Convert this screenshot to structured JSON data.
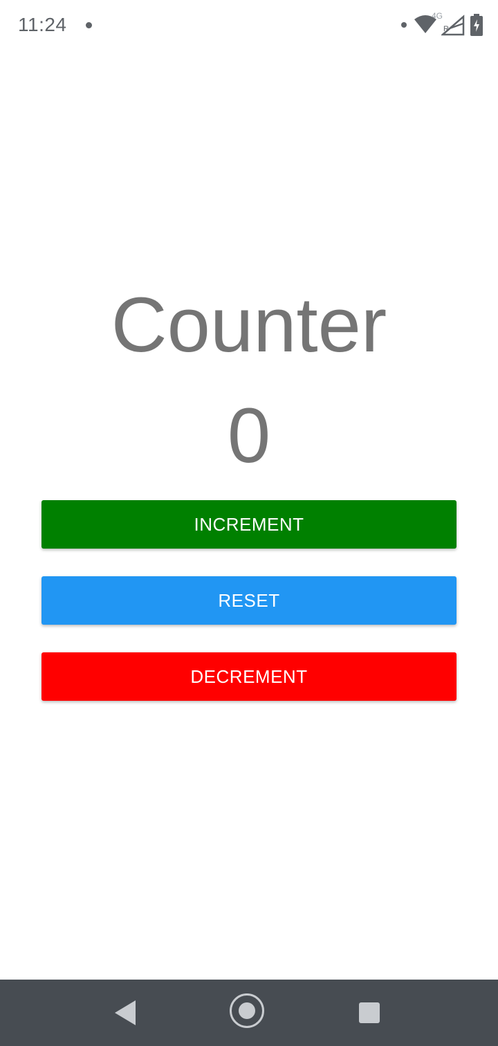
{
  "status_bar": {
    "time": "11:24",
    "network_label": "4G",
    "roaming_label": "R",
    "icons": [
      "notification-dot-icon",
      "wifi-icon",
      "cell-signal-icon",
      "battery-charging-icon"
    ]
  },
  "main": {
    "title": "Counter",
    "count": "0",
    "buttons": {
      "increment_label": "INCREMENT",
      "reset_label": "RESET",
      "decrement_label": "DECREMENT"
    }
  },
  "nav_bar": {
    "icons": [
      "back-icon",
      "home-icon",
      "recent-apps-icon"
    ]
  },
  "colors": {
    "increment": "#008000",
    "reset": "#2196f3",
    "decrement": "#ff0000",
    "text_gray": "#757575",
    "nav_bar": "#474c52"
  }
}
